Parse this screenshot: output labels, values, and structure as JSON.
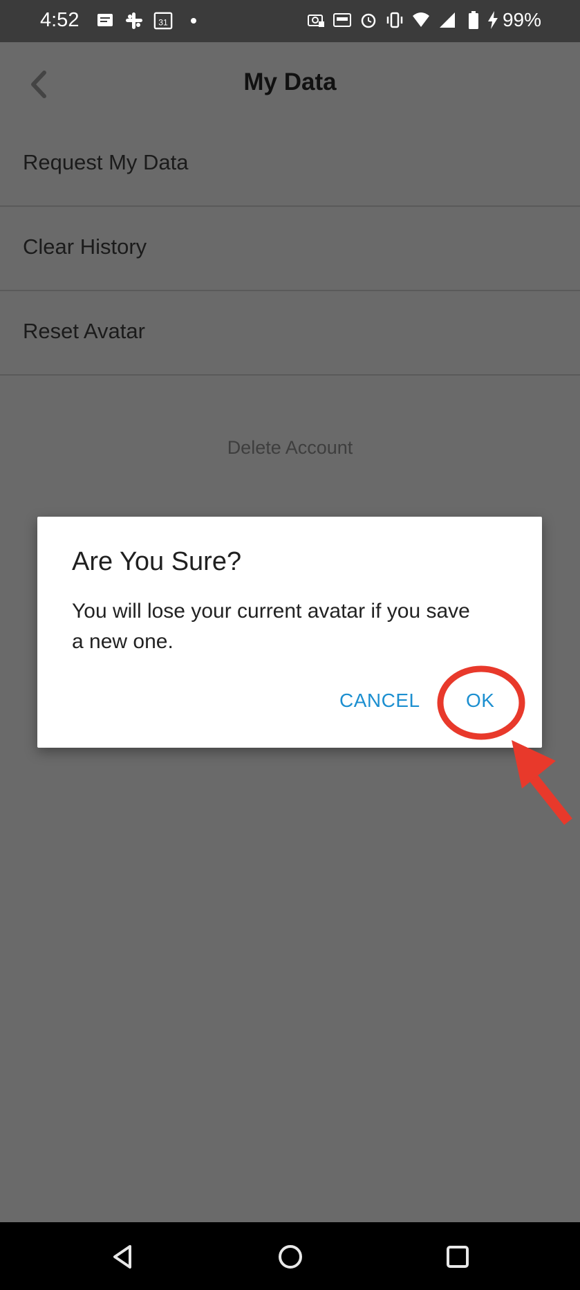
{
  "status_bar": {
    "time": "4:52",
    "left_icons": [
      "messages-icon",
      "slack-icon",
      "calendar-icon",
      "dot-icon"
    ],
    "calendar_day": "31",
    "right_icons": [
      "screenshot-icon",
      "auto-hz-icon",
      "alarm-icon",
      "vibrate-icon",
      "wifi-icon",
      "signal-icon",
      "battery-icon",
      "charging-icon"
    ],
    "battery": "99%"
  },
  "header": {
    "title": "My Data",
    "back_icon": "chevron-left-icon"
  },
  "menu": {
    "items": [
      {
        "label": "Request My Data"
      },
      {
        "label": "Clear History"
      },
      {
        "label": "Reset Avatar"
      }
    ],
    "delete_account": "Delete Account"
  },
  "dialog": {
    "title": "Are You Sure?",
    "message": "You will lose your current avatar if you save a new one.",
    "cancel_label": "CANCEL",
    "ok_label": "OK",
    "button_color": "#1c8fd0"
  },
  "annotation": {
    "color": "#e8392b",
    "shapes": [
      "highlight-circle",
      "pointer-arrow"
    ]
  },
  "navbar": {
    "icons": [
      "back-triangle-icon",
      "home-circle-icon",
      "recents-square-icon"
    ]
  }
}
